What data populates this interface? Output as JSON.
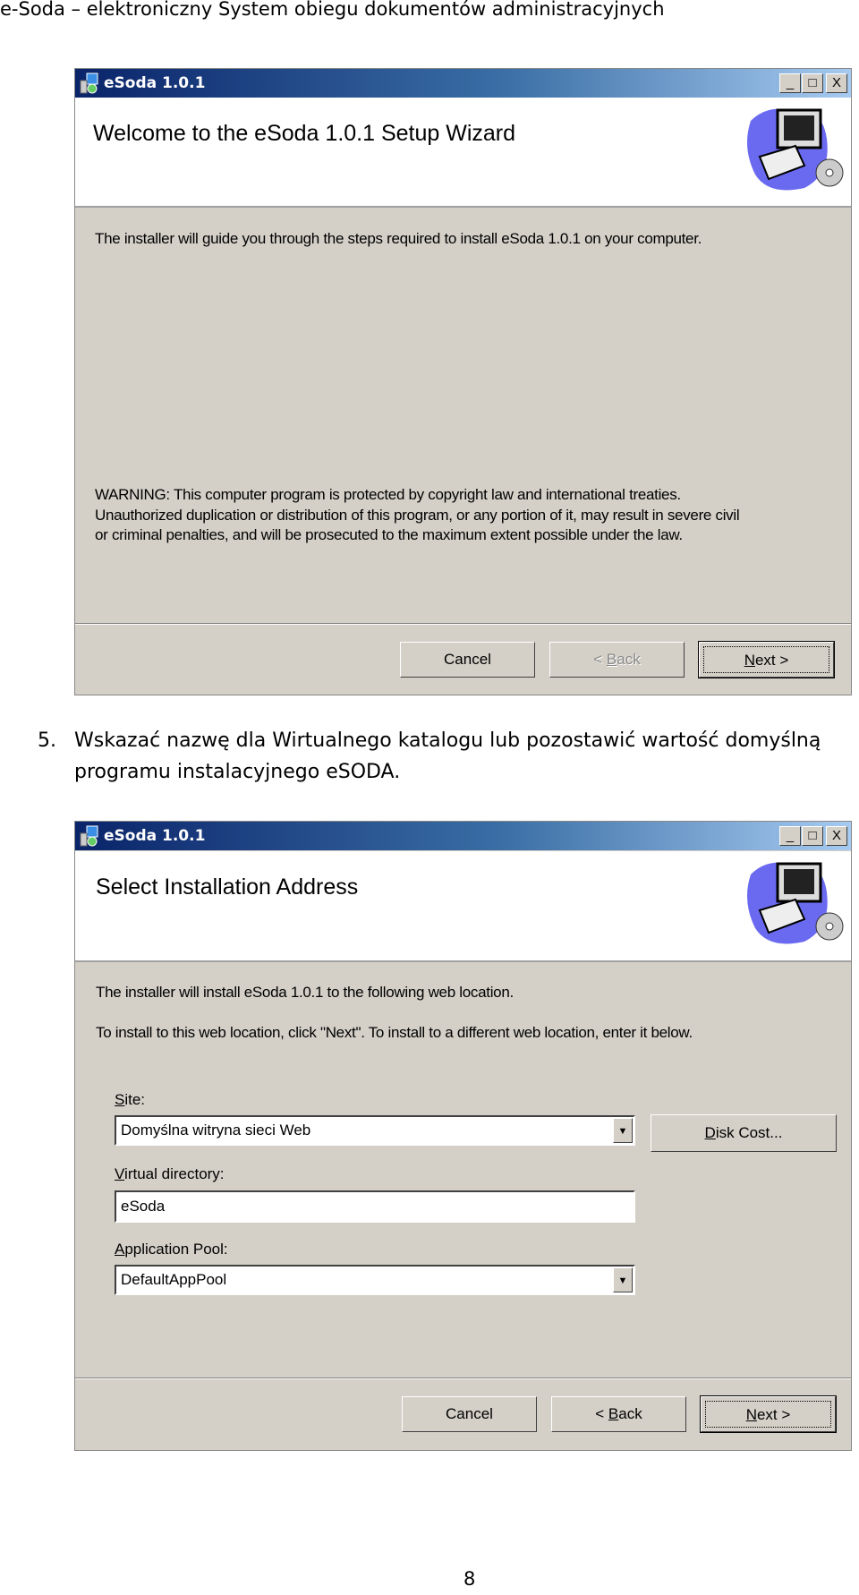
{
  "page_header": "e-Soda – elektroniczny System obiegu dokumentów administracyjnych",
  "step": {
    "number": "5.",
    "line1": "Wskazać nazwę dla Wirtualnego katalogu lub pozostawić wartość domyślną",
    "line2": "programu instalacyjnego eSODA."
  },
  "page_number": "8",
  "window1": {
    "title": "eSoda 1.0.1",
    "controls": {
      "minimize": "_",
      "maximize": "□",
      "close": "X"
    },
    "heading": "Welcome to the eSoda 1.0.1 Setup Wizard",
    "intro": "The installer will guide you through the steps required to install eSoda 1.0.1 on your computer.",
    "warning": [
      "WARNING: This computer program is protected by copyright law and international treaties.",
      "Unauthorized duplication or distribution of this program, or any portion of it, may result in severe civil",
      "or criminal penalties, and will be prosecuted to the maximum extent possible under the law."
    ],
    "buttons": {
      "cancel": "Cancel",
      "back_pre": "< ",
      "back_key": "B",
      "back_post": "ack",
      "next_key": "N",
      "next_post": "ext >"
    },
    "back_enabled": false
  },
  "window2": {
    "title": "eSoda 1.0.1",
    "controls": {
      "minimize": "_",
      "maximize": "□",
      "close": "X"
    },
    "heading": "Select Installation Address",
    "line1": "The installer will install eSoda 1.0.1 to the following web location.",
    "line2": "To install to this web location, click \"Next\". To install to a different web location, enter it below.",
    "site": {
      "label_key": "S",
      "label_rest": "ite:",
      "value": "Domyślna witryna sieci Web"
    },
    "disk_cost": {
      "key": "D",
      "rest": "isk Cost..."
    },
    "virtual_directory": {
      "label_key": "V",
      "label_rest": "irtual directory:",
      "value": "eSoda"
    },
    "app_pool": {
      "label_key": "A",
      "label_rest": "pplication Pool:",
      "value": "DefaultAppPool"
    },
    "buttons": {
      "cancel": "Cancel",
      "back_pre": "< ",
      "back_key": "B",
      "back_post": "ack",
      "next_key": "N",
      "next_post": "ext >"
    },
    "back_enabled": true
  },
  "colors": {
    "dialog_bg": "#d4d0c8",
    "titlebar_start": "#0a246a",
    "titlebar_end": "#a6caf0"
  }
}
